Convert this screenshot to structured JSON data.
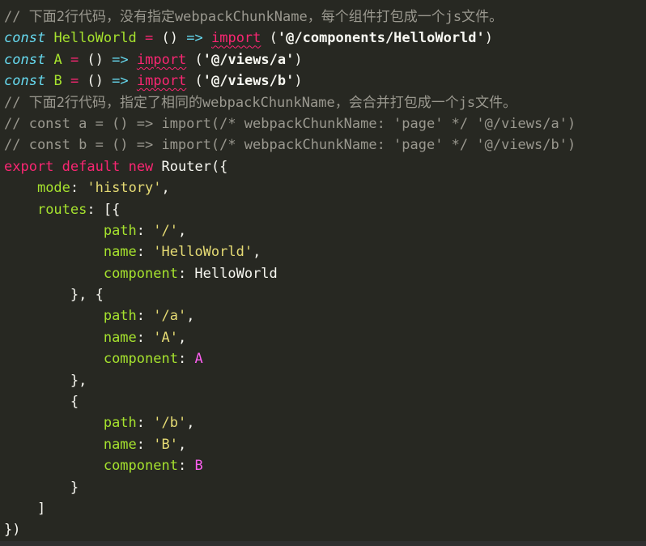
{
  "colors": {
    "background": "#272822",
    "comment": "#9a988f",
    "storage": "#66d9ef",
    "entity": "#a6e22e",
    "keyword": "#f92672",
    "string": "#e6db74",
    "text": "#f8f8f2",
    "number": "#fd5ff0"
  },
  "code_lines": [
    [
      {
        "t": "// 下面2行代码，没有指定webpackChunkName，每个组件打包成一个js文件。",
        "k": "comment"
      }
    ],
    [
      {
        "t": "const",
        "k": "storage"
      },
      {
        "t": " ",
        "k": "plain"
      },
      {
        "t": "HelloWorld",
        "k": "entity"
      },
      {
        "t": " ",
        "k": "plain"
      },
      {
        "t": "=",
        "k": "op"
      },
      {
        "t": " () ",
        "k": "plain"
      },
      {
        "t": "=>",
        "k": "arrow"
      },
      {
        "t": " ",
        "k": "plain"
      },
      {
        "t": "import",
        "k": "squiggle"
      },
      {
        "t": " (",
        "k": "plain"
      },
      {
        "t": "'@/components/HelloWorld'",
        "k": "strong"
      },
      {
        "t": ")",
        "k": "plain"
      }
    ],
    [
      {
        "t": "const",
        "k": "storage"
      },
      {
        "t": " ",
        "k": "plain"
      },
      {
        "t": "A",
        "k": "entity"
      },
      {
        "t": " ",
        "k": "plain"
      },
      {
        "t": "=",
        "k": "op"
      },
      {
        "t": " () ",
        "k": "plain"
      },
      {
        "t": "=>",
        "k": "arrow"
      },
      {
        "t": " ",
        "k": "plain"
      },
      {
        "t": "import",
        "k": "squiggle"
      },
      {
        "t": " (",
        "k": "plain"
      },
      {
        "t": "'@/views/a'",
        "k": "strong"
      },
      {
        "t": ")",
        "k": "plain"
      }
    ],
    [
      {
        "t": "const",
        "k": "storage"
      },
      {
        "t": " ",
        "k": "plain"
      },
      {
        "t": "B",
        "k": "entity"
      },
      {
        "t": " ",
        "k": "plain"
      },
      {
        "t": "=",
        "k": "op"
      },
      {
        "t": " () ",
        "k": "plain"
      },
      {
        "t": "=>",
        "k": "arrow"
      },
      {
        "t": " ",
        "k": "plain"
      },
      {
        "t": "import",
        "k": "squiggle"
      },
      {
        "t": " (",
        "k": "plain"
      },
      {
        "t": "'@/views/b'",
        "k": "strong"
      },
      {
        "t": ")",
        "k": "plain"
      }
    ],
    [
      {
        "t": "// 下面2行代码，指定了相同的webpackChunkName，会合并打包成一个js文件。",
        "k": "comment"
      }
    ],
    [
      {
        "t": "// const a = () => import(/* webpackChunkName: 'page' */ '@/views/a')",
        "k": "comment"
      }
    ],
    [
      {
        "t": "// const b = () => import(/* webpackChunkName: 'page' */ '@/views/b')",
        "k": "comment"
      }
    ],
    [
      {
        "t": "export",
        "k": "keyword"
      },
      {
        "t": " ",
        "k": "plain"
      },
      {
        "t": "default",
        "k": "keyword"
      },
      {
        "t": " ",
        "k": "plain"
      },
      {
        "t": "new",
        "k": "keyword"
      },
      {
        "t": " Router({",
        "k": "plain"
      }
    ],
    [
      {
        "t": "    ",
        "k": "plain"
      },
      {
        "t": "mode",
        "k": "prop"
      },
      {
        "t": ": ",
        "k": "plain"
      },
      {
        "t": "'history'",
        "k": "string"
      },
      {
        "t": ",",
        "k": "plain"
      }
    ],
    [
      {
        "t": "    ",
        "k": "plain"
      },
      {
        "t": "routes",
        "k": "prop"
      },
      {
        "t": ": [{",
        "k": "plain"
      }
    ],
    [
      {
        "t": "            ",
        "k": "plain"
      },
      {
        "t": "path",
        "k": "prop"
      },
      {
        "t": ": ",
        "k": "plain"
      },
      {
        "t": "'/'",
        "k": "string"
      },
      {
        "t": ",",
        "k": "plain"
      }
    ],
    [
      {
        "t": "            ",
        "k": "plain"
      },
      {
        "t": "name",
        "k": "prop"
      },
      {
        "t": ": ",
        "k": "plain"
      },
      {
        "t": "'HelloWorld'",
        "k": "string"
      },
      {
        "t": ",",
        "k": "plain"
      }
    ],
    [
      {
        "t": "            ",
        "k": "plain"
      },
      {
        "t": "component",
        "k": "prop"
      },
      {
        "t": ": HelloWorld",
        "k": "plain"
      }
    ],
    [
      {
        "t": "        }, {",
        "k": "plain"
      }
    ],
    [
      {
        "t": "            ",
        "k": "plain"
      },
      {
        "t": "path",
        "k": "prop"
      },
      {
        "t": ": ",
        "k": "plain"
      },
      {
        "t": "'/a'",
        "k": "string"
      },
      {
        "t": ",",
        "k": "plain"
      }
    ],
    [
      {
        "t": "            ",
        "k": "plain"
      },
      {
        "t": "name",
        "k": "prop"
      },
      {
        "t": ": ",
        "k": "plain"
      },
      {
        "t": "'A'",
        "k": "string"
      },
      {
        "t": ",",
        "k": "plain"
      }
    ],
    [
      {
        "t": "            ",
        "k": "plain"
      },
      {
        "t": "component",
        "k": "prop"
      },
      {
        "t": ": ",
        "k": "plain"
      },
      {
        "t": "A",
        "k": "magenta"
      }
    ],
    [
      {
        "t": "        },",
        "k": "plain"
      }
    ],
    [
      {
        "t": "        {",
        "k": "plain"
      }
    ],
    [
      {
        "t": "            ",
        "k": "plain"
      },
      {
        "t": "path",
        "k": "prop"
      },
      {
        "t": ": ",
        "k": "plain"
      },
      {
        "t": "'/b'",
        "k": "string"
      },
      {
        "t": ",",
        "k": "plain"
      }
    ],
    [
      {
        "t": "            ",
        "k": "plain"
      },
      {
        "t": "name",
        "k": "prop"
      },
      {
        "t": ": ",
        "k": "plain"
      },
      {
        "t": "'B'",
        "k": "string"
      },
      {
        "t": ",",
        "k": "plain"
      }
    ],
    [
      {
        "t": "            ",
        "k": "plain"
      },
      {
        "t": "component",
        "k": "prop"
      },
      {
        "t": ": ",
        "k": "plain"
      },
      {
        "t": "B",
        "k": "magenta"
      }
    ],
    [
      {
        "t": "        }",
        "k": "plain"
      }
    ],
    [
      {
        "t": "    ]",
        "k": "plain"
      }
    ],
    [
      {
        "t": "})",
        "k": "plain"
      }
    ]
  ]
}
